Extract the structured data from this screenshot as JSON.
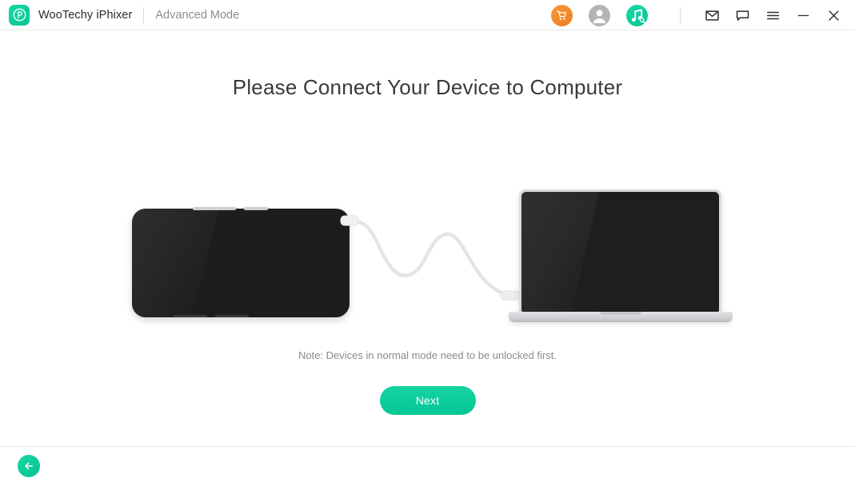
{
  "titlebar": {
    "logo_icon": "p-logo-icon",
    "app_name": "WooTechy iPhixer",
    "mode_label": "Advanced Mode",
    "icons": [
      {
        "name": "shopping-cart-icon",
        "color": "#ed7b1f"
      },
      {
        "name": "user-account-icon",
        "color": "#b4b4b4"
      },
      {
        "name": "music-search-icon",
        "color": "#07c394"
      },
      {
        "name": "mail-icon",
        "color": "#333333"
      },
      {
        "name": "feedback-chat-icon",
        "color": "#333333"
      },
      {
        "name": "menu-hamburger-icon",
        "color": "#333333"
      },
      {
        "name": "minimize-icon",
        "color": "#333333"
      },
      {
        "name": "close-icon",
        "color": "#333333"
      }
    ]
  },
  "main": {
    "heading": "Please Connect Your Device to Computer",
    "note": "Note: Devices in normal mode need to be unlocked first.",
    "next_label": "Next",
    "illustration": {
      "phone_label": "mobile-device",
      "laptop_label": "computer",
      "cable_label": "usb-cable"
    }
  },
  "footer": {
    "back_icon": "arrow-left-icon"
  },
  "colors": {
    "accent_green": "#07c394",
    "cart_orange": "#ed7b1f",
    "heading_gray": "#3a3a3a",
    "note_gray": "#8b8b8b",
    "border_gray": "#e8e8e8"
  }
}
